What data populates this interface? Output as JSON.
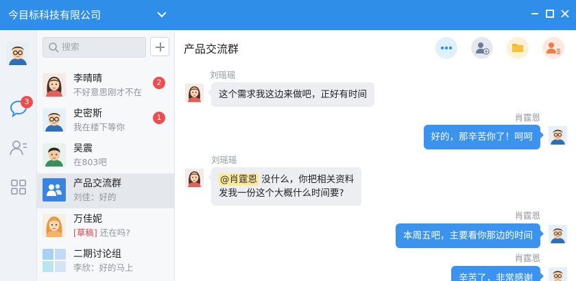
{
  "window": {
    "title": "今目标科技有限公司"
  },
  "search": {
    "placeholder": "搜索"
  },
  "rail": {
    "messages_badge": "3"
  },
  "conversations": [
    {
      "name": "李晴晴",
      "preview": "不好意思刚才不在",
      "badge": "2",
      "avatar": "woman"
    },
    {
      "name": "史密斯",
      "preview": "我在楼下等你",
      "badge": "1",
      "avatar": "man-glasses"
    },
    {
      "name": "吴震",
      "preview": "在803吧",
      "badge": "",
      "avatar": "man"
    },
    {
      "name": "产品交流群",
      "preview": "刘佳：好的",
      "badge": "",
      "avatar": "group-icon",
      "selected": true
    },
    {
      "name": "万佳妮",
      "draft": "[草稿]",
      "preview": "还在吗?",
      "badge": "",
      "avatar": "woman-blonde"
    },
    {
      "name": "二期讨论组",
      "preview": "李欣：好的马上",
      "badge": "",
      "avatar": "group-tiles"
    }
  ],
  "chat": {
    "title": "产品交流群",
    "toolbar": [
      "more-icon",
      "add-member-icon",
      "folder-icon",
      "member-list-icon"
    ],
    "messages": [
      {
        "sender": "刘瑶瑶",
        "direction": "in",
        "text": "这个需求我这边来做吧，正好有时间"
      },
      {
        "sender": "肖霆恩",
        "direction": "out",
        "text": "好的，那辛苦你了！呵呵"
      },
      {
        "sender": "刘瑶瑶",
        "direction": "in",
        "mention": "@肖霆恩",
        "line1": " 没什么，你把相关资料",
        "line2": "发我一份这个大概什么时间要?"
      },
      {
        "sender": "肖霆恩",
        "direction": "out",
        "text": "本周五吧，主要看你那边的时间"
      },
      {
        "sender": "肖霆恩",
        "direction": "out",
        "text": "辛苦了，非常感谢"
      }
    ]
  },
  "colors": {
    "accent": "#2f8ee8",
    "bubble_out": "#3b93ee",
    "badge": "#ef4d4d",
    "mention": "#fde99a"
  }
}
